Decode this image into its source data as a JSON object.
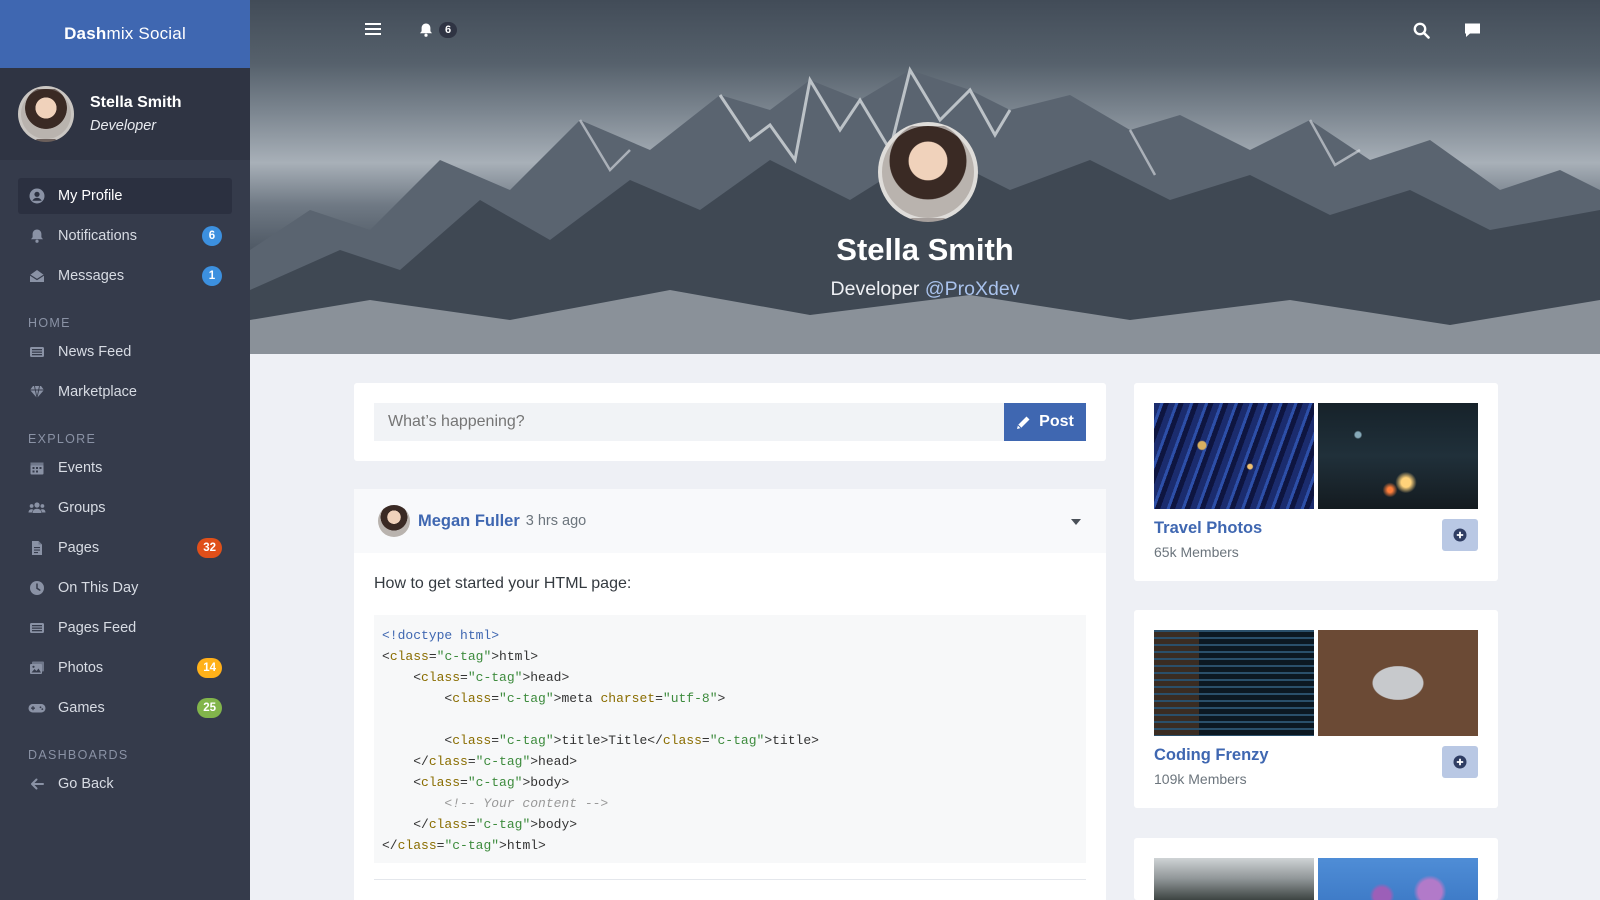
{
  "brand": {
    "bold": "Dash",
    "rest": "mix Social"
  },
  "user": {
    "name": "Stella Smith",
    "role": "Developer"
  },
  "nav_main": [
    {
      "label": "My Profile",
      "icon": "user-circle-icon",
      "active": true
    },
    {
      "label": "Notifications",
      "icon": "bell-icon",
      "badge": "6",
      "badge_color": "#3c90df"
    },
    {
      "label": "Messages",
      "icon": "envelope-open-icon",
      "badge": "1",
      "badge_color": "#3c90df"
    }
  ],
  "nav_home": {
    "heading": "Home",
    "items": [
      {
        "label": "News Feed",
        "icon": "newspaper-icon"
      },
      {
        "label": "Marketplace",
        "icon": "gem-icon"
      }
    ]
  },
  "nav_explore": {
    "heading": "Explore",
    "items": [
      {
        "label": "Events",
        "icon": "calendar-icon"
      },
      {
        "label": "Groups",
        "icon": "users-icon"
      },
      {
        "label": "Pages",
        "icon": "file-icon",
        "badge": "32",
        "badge_color": "#e04f1a"
      },
      {
        "label": "On This Day",
        "icon": "clock-icon"
      },
      {
        "label": "Pages Feed",
        "icon": "newspaper-icon"
      },
      {
        "label": "Photos",
        "icon": "images-icon",
        "badge": "14",
        "badge_color": "#ffb119"
      },
      {
        "label": "Games",
        "icon": "gamepad-icon",
        "badge": "25",
        "badge_color": "#82b54b"
      }
    ]
  },
  "nav_dashboards": {
    "heading": "Dashboards",
    "items": [
      {
        "label": "Go Back",
        "icon": "arrow-left-icon"
      }
    ]
  },
  "header": {
    "notification_count": "6"
  },
  "hero": {
    "name": "Stella Smith",
    "role": "Developer",
    "handle": "@ProXdev"
  },
  "composer": {
    "placeholder": "What’s happening?",
    "post_label": "Post"
  },
  "post": {
    "author": "Megan Fuller",
    "time": "3 hrs ago",
    "intro": "How to get started your HTML page:",
    "code": [
      "<!doctype html>",
      "<html>",
      "    <head>",
      "        <meta charset=\"utf-8\">",
      "",
      "        <title>Title</title>",
      "    </head>",
      "    <body>",
      "        <!-- Your content -->",
      "    </body>",
      "</html>"
    ]
  },
  "groups": [
    {
      "name": "Travel Photos",
      "members": "65k Members"
    },
    {
      "name": "Coding Frenzy",
      "members": "109k Members"
    }
  ],
  "colors": {
    "brand": "#3f67b1",
    "sidebar": "#353b4b",
    "sidebar_user": "#2f3443",
    "link": "#3f67b1"
  }
}
